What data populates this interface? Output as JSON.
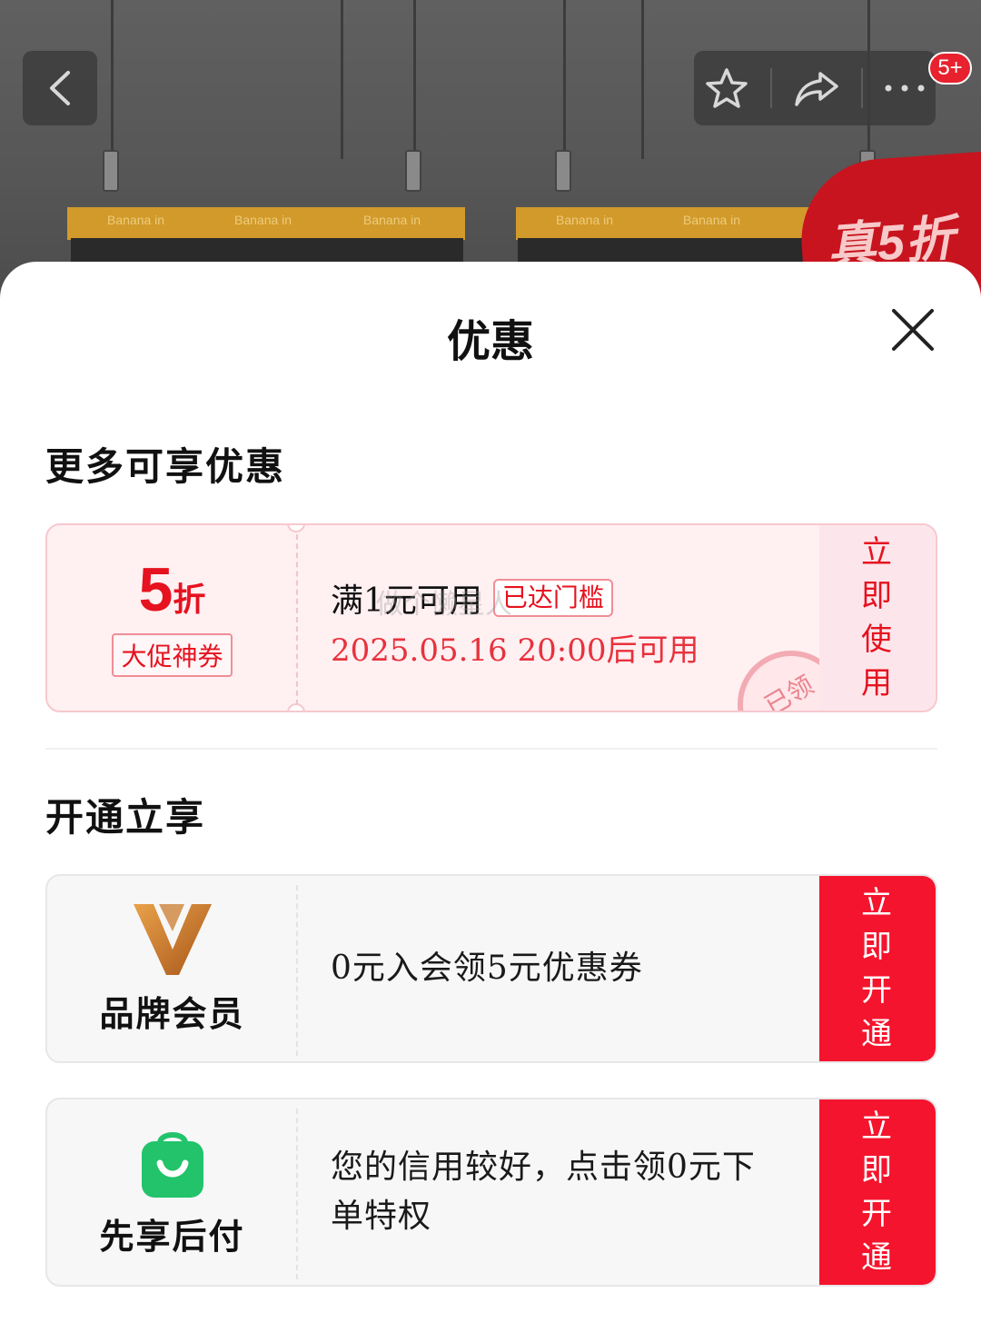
{
  "nav": {
    "badge_count": "5+"
  },
  "background": {
    "brand": "Banana in",
    "promo_badge": "真5折"
  },
  "sheet": {
    "title": "优惠",
    "sections": {
      "more_offers": "更多可享优惠",
      "activate": "开通立享"
    },
    "coupon": {
      "discount_value": "5",
      "discount_unit": "折",
      "tag": "大促神券",
      "condition": "满1元可用",
      "status": "已达门槛",
      "validity": "2025.05.16 20:00后可用",
      "watermark": "做个懒星人",
      "stamp": "已领",
      "action": "立即使用"
    },
    "member_cards": [
      {
        "icon": "brand-member-logo-icon",
        "label": "品牌会员",
        "description": "0元入会领5元优惠券",
        "action": "立即开通"
      },
      {
        "icon": "shopping-bag-icon",
        "label": "先享后付",
        "description": "您的信用较好，点击领0元下单特权",
        "action": "立即开通"
      }
    ]
  },
  "colors": {
    "accent_red": "#f5142d",
    "coupon_bg": "#fff0f2",
    "member_gold": "#c8741f",
    "pay_green": "#22c36a"
  }
}
